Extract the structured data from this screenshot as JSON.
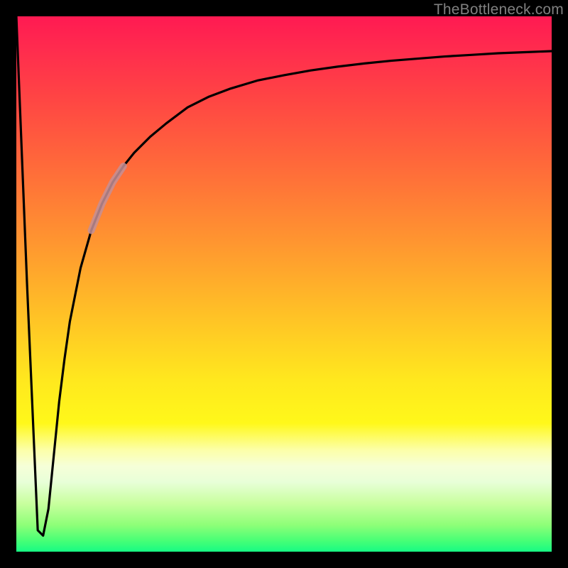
{
  "watermark": "TheBottleneck.com",
  "colors": {
    "frame": "#000000",
    "curve": "#000000",
    "highlight": "#c48f96",
    "watermark": "#808080"
  },
  "chart_data": {
    "type": "line",
    "title": "",
    "xlabel": "",
    "ylabel": "",
    "xlim": [
      0,
      100
    ],
    "ylim": [
      0,
      100
    ],
    "grid": false,
    "series": [
      {
        "name": "bottleneck-curve",
        "x": [
          0,
          2,
          4,
          5,
          6,
          7,
          8,
          9,
          10,
          12,
          14,
          16,
          18,
          20,
          22,
          25,
          28,
          32,
          36,
          40,
          45,
          50,
          55,
          60,
          65,
          70,
          75,
          80,
          85,
          90,
          95,
          100
        ],
        "values": [
          100,
          50,
          4,
          3,
          8,
          18,
          28,
          36,
          43,
          53,
          60,
          65,
          69,
          72,
          74.5,
          77.5,
          80,
          83,
          85,
          86.5,
          88,
          89,
          89.9,
          90.6,
          91.2,
          91.7,
          92.1,
          92.5,
          92.8,
          93.1,
          93.3,
          93.5
        ]
      }
    ],
    "highlight_range": {
      "x_start": 14,
      "x_end": 20
    }
  }
}
